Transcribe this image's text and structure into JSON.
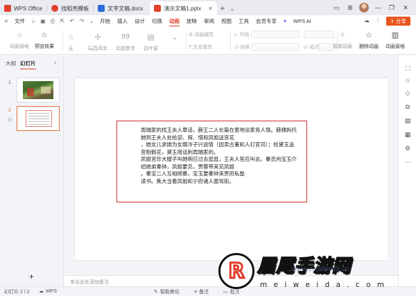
{
  "titlebar": {
    "tabs": [
      {
        "label": "WPS Office",
        "color": "#e0412d"
      },
      {
        "label": "找稻壳模板",
        "color": "#e0412d"
      },
      {
        "label": "文字文稿.docx",
        "color": "#2b6cd8"
      },
      {
        "label": "演示文稿1.pptx",
        "color": "#e0412d"
      }
    ]
  },
  "menubar": {
    "file_label": "文件",
    "items": [
      "开始",
      "插入",
      "设计",
      "切换",
      "动画",
      "放映",
      "审阅",
      "视图",
      "工具",
      "会员专享"
    ],
    "active_item": "动画",
    "wps_ai_label": "WPS AI",
    "share_label": "分享"
  },
  "ribbon": {
    "animation_pane_label": "动画窗格",
    "preview_label": "预览效果",
    "effects": [
      "无",
      "玩具风车",
      "动态数字",
      "百叶窗"
    ],
    "effect_options_label": "动画属性",
    "text_properties_label": "文本属性",
    "start_label": "开始",
    "duration_label": "持续",
    "delay_label": "延迟",
    "smart_animation_label": "智能动画",
    "delete_animation_label": "删除动画",
    "animation_pane_right_label": "动画窗格"
  },
  "leftpanel": {
    "outline_tab": "大纲",
    "slides_tab": "幻灯片",
    "slide_numbers": [
      "1",
      "2"
    ]
  },
  "slide": {
    "lines": [
      "周瑞家的找王夫人章话，薛王二人长篇在套地谈家务人情。薛姨妈托",
      "她到王夫人处给迎、探、惜和凤姐送宫花",
      "，她女儿求她为女婿冷子兴说情（因卖古董和人打官司）；给黛玉送",
      "宫制假花，黛玉用话刺周瑞家的。",
      "凤姐宫珍大嫂子叫她明日过去逛逛，王夫人答应叫去。秦氏向宝玉介",
      "绍她弟秦钟，凤姐要见，贾蓉带来见凤姐",
      "。秦宝二人互相倾慕，宝玉要秦钟来贾府私塾",
      "读书。焦大当着凤姐和宁府诸人面骂街。"
    ]
  },
  "notes": {
    "placeholder": "单击此处添加备注"
  },
  "statusbar": {
    "slide_counter": "幻灯片 2 / 2",
    "app_label": "WPS",
    "smart_beautify": "智能美化",
    "notes_label": "备注",
    "comments_label": "批注"
  },
  "watermark": {
    "logo_char": "R",
    "title": "眉尾手游网",
    "url": "m e i w e i d a . c o m",
    "faint_text": "www.zuodlewf8.cn"
  },
  "colors": {
    "accent": "#e0412d",
    "share": "#e8541e",
    "textbox_border": "#c9302c"
  }
}
